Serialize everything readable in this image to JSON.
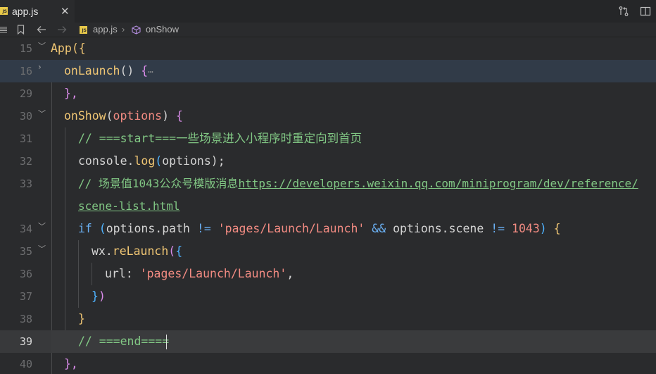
{
  "tab": {
    "badge": "JS",
    "label": "app.js",
    "close": "✕"
  },
  "breadcrumb": {
    "file": "app.js",
    "separator": "›",
    "symbol": "onShow"
  },
  "editor": {
    "line_numbers": [
      "15",
      "16",
      "29",
      "30",
      "31",
      "32",
      "33",
      "",
      "34",
      "35",
      "36",
      "37",
      "38",
      "39",
      "40"
    ],
    "lines": {
      "l15": {
        "a": "App",
        "b": "({"
      },
      "l16": {
        "a": "onLaunch",
        "b": "() ",
        "c": "{",
        "d": "⋯"
      },
      "l29": {
        "a": "},"
      },
      "l30": {
        "a": "onShow",
        "b": "(",
        "c": "options",
        "d": ") ",
        "e": "{"
      },
      "l31": {
        "a": "// ===start===一些场景进入小程序时重定向到首页"
      },
      "l32": {
        "a": "console",
        "b": ".",
        "c": "log",
        "d": "(",
        "e": "options",
        "f": ");"
      },
      "l33": {
        "a": "// 场景值1043公众号模版消息",
        "b": "https://developers.weixin.qq.com/miniprogram/dev/reference/"
      },
      "l33b": {
        "a": "scene-list.html"
      },
      "l34": {
        "a": "if",
        "b": " (",
        "c": "options",
        "d": ".",
        "e": "path",
        "f": " != ",
        "g": "'pages/Launch/Launch'",
        "h": " && ",
        "i": "options",
        "j": ".",
        "k": "scene",
        "l": " != ",
        "m": "1043",
        "n": ") ",
        "o": "{"
      },
      "l35": {
        "a": "wx",
        "b": ".",
        "c": "reLaunch",
        "d": "(",
        "e": "{"
      },
      "l36": {
        "a": "url",
        "b": ": ",
        "c": "'pages/Launch/Launch'",
        "d": ","
      },
      "l37": {
        "a": "}",
        "b": ")"
      },
      "l38": {
        "a": "}"
      },
      "l39": {
        "a": "// ===end===="
      },
      "l40": {
        "a": "},"
      }
    }
  }
}
